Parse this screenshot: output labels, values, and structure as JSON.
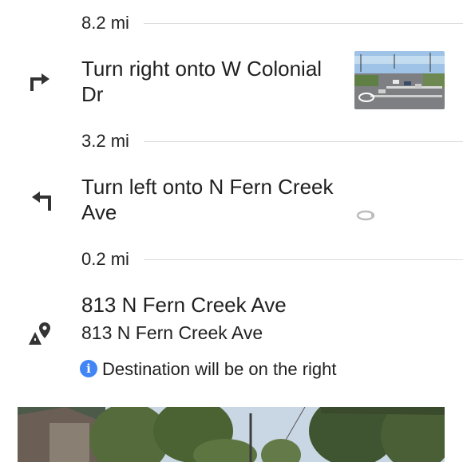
{
  "steps": [
    {
      "distance_before": "8.2 mi",
      "instruction": "Turn right onto W Colonial Dr",
      "icon": "turn-right-icon"
    },
    {
      "distance_before": "3.2 mi",
      "instruction": "Turn left onto N Fern Creek Ave",
      "icon": "turn-left-icon"
    }
  ],
  "final_distance": "0.2 mi",
  "destination": {
    "title": "813 N Fern Creek Ave",
    "address": "813 N Fern Creek Ave",
    "icon": "destination-pin-icon",
    "note": "Destination will be on the right",
    "note_icon": "info-icon"
  },
  "colors": {
    "accent": "#4285f4",
    "text": "#212121",
    "divider": "#dcdcdc"
  }
}
